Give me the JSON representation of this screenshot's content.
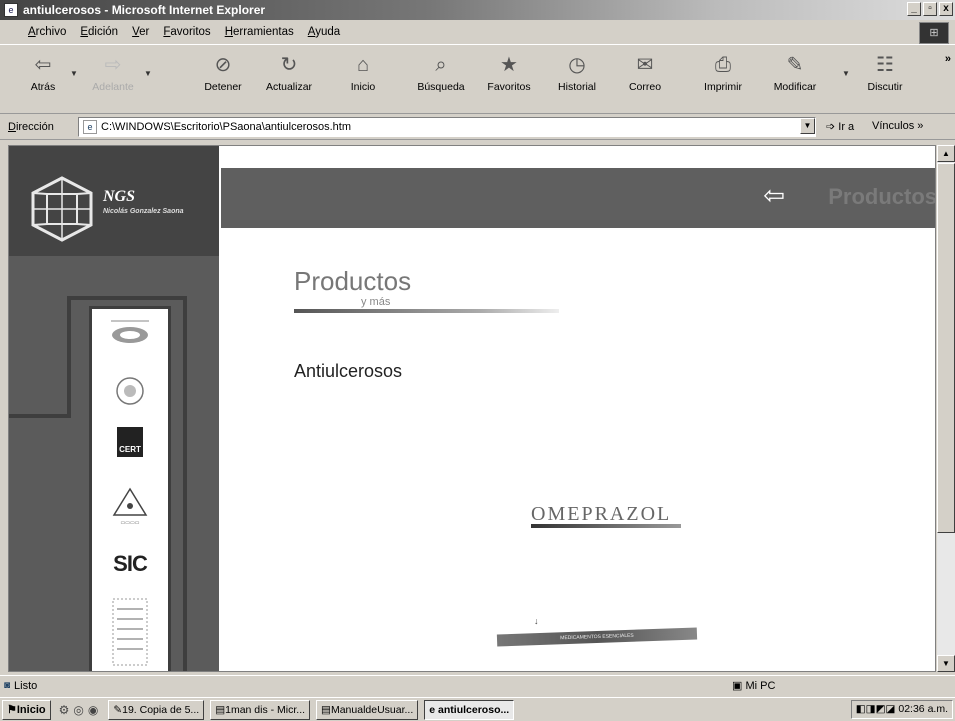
{
  "window": {
    "title": "antiulcerosos - Microsoft Internet Explorer",
    "buttons": {
      "minimize": "_",
      "restore": "▫",
      "close": "x"
    }
  },
  "menu": {
    "items": [
      "Archivo",
      "Edición",
      "Ver",
      "Favoritos",
      "Herramientas",
      "Ayuda"
    ]
  },
  "toolbar": {
    "back": "Atrás",
    "forward": "Adelante",
    "stop": "Detener",
    "refresh": "Actualizar",
    "home": "Inicio",
    "search": "Búsqueda",
    "favorites": "Favoritos",
    "history": "Historial",
    "mail": "Correo",
    "print": "Imprimir",
    "edit": "Modificar",
    "discuss": "Discutir",
    "more": "»"
  },
  "address": {
    "label": "Dirección",
    "value": "C:\\WINDOWS\\Escritorio\\PSaona\\antiulcerosos.htm",
    "go": "Ir a",
    "links": "Vínculos »"
  },
  "page": {
    "logo_title": "NGS",
    "logo_subtitle": "Nicolás Gonzalez Saona",
    "banner_arrow": "⇦",
    "banner_text": "Productos",
    "heading": "Productos",
    "heading_sub": "y más",
    "section": "Antiulcerosos",
    "product": "OMEPRAZOL",
    "product_band": "MEDICAMENTOS ESENCIALES",
    "certs": [
      "CERT",
      "SIC"
    ]
  },
  "status": {
    "text": "Listo",
    "zone": "Mi PC"
  },
  "taskbar": {
    "start": "Inicio",
    "tasks": [
      {
        "label": "19. Copia de 5...",
        "active": false
      },
      {
        "label": "1man dis - Micr...",
        "active": false
      },
      {
        "label": "ManualdeUsuar...",
        "active": false
      },
      {
        "label": "antiulceroso...",
        "active": true
      }
    ],
    "clock": "02:36 a.m."
  },
  "colors": {
    "title_gradient_start": "#444444",
    "sidebar": "#5b5b5b",
    "banner": "#5f5f5f",
    "chrome": "#d4d0c8"
  }
}
